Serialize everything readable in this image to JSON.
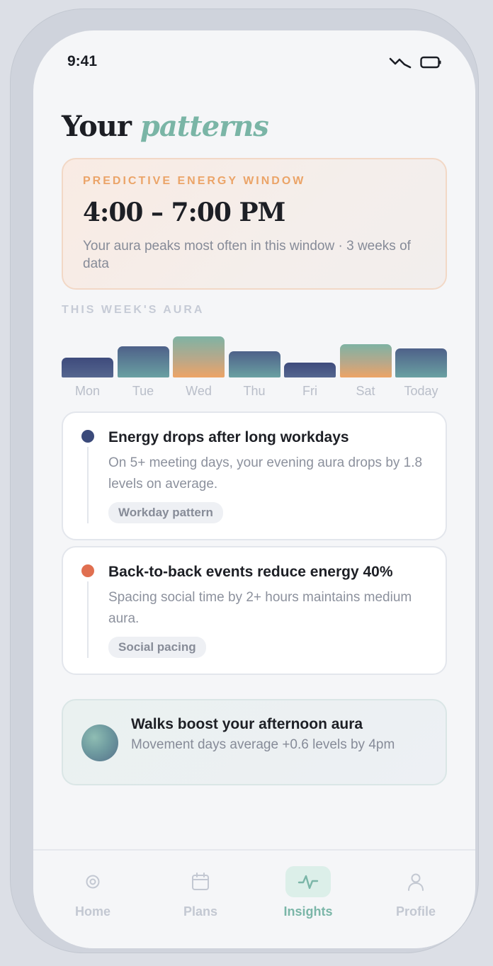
{
  "status_bar": {
    "time": "9:41",
    "icons": [
      "signal-icon",
      "battery-icon"
    ]
  },
  "header": {
    "title_plain": "Your",
    "title_accent": "patterns"
  },
  "energy_window": {
    "label": "PREDICTIVE ENERGY WINDOW",
    "time_range": "4:00 – 7:00 PM",
    "description": "Your aura peaks most often in this window · 3 weeks of data"
  },
  "week_aura": {
    "label": "THIS WEEK'S AURA"
  },
  "chart_data": {
    "type": "bar",
    "categories": [
      "Mon",
      "Tue",
      "Wed",
      "Thu",
      "Fri",
      "Sat",
      "Today"
    ],
    "values": [
      0.48,
      0.76,
      1.0,
      0.64,
      0.36,
      0.81,
      0.7
    ],
    "title": "",
    "xlabel": "",
    "ylabel": "",
    "ylim": [
      0,
      1
    ],
    "grid": false
  },
  "insights": [
    {
      "title": "Energy drops after long workdays",
      "body": "On 5+ meeting days, your evening aura drops by 1.8 levels on average.",
      "tag": "Workday pattern",
      "dot_color": "#3b4a7a"
    },
    {
      "title": "Back-to-back events reduce energy 40%",
      "body": "Spacing social time by 2+ hours maintains medium aura.",
      "tag": "Social pacing",
      "dot_color": "#e06f50"
    }
  ],
  "walk_card": {
    "title": "Walks boost your afternoon aura",
    "body": "Movement days average +0.6 levels by 4pm"
  },
  "tabbar": {
    "items": [
      {
        "label": "Home",
        "icon": "home-icon",
        "active": false
      },
      {
        "label": "Plans",
        "icon": "calendar-icon",
        "active": false
      },
      {
        "label": "Insights",
        "icon": "pulse-icon",
        "active": true
      },
      {
        "label": "Profile",
        "icon": "user-icon",
        "active": false
      }
    ]
  },
  "colors": {
    "accent": "#7ab5a6",
    "warm": "#eba468",
    "navy": "#3b4a7a"
  }
}
